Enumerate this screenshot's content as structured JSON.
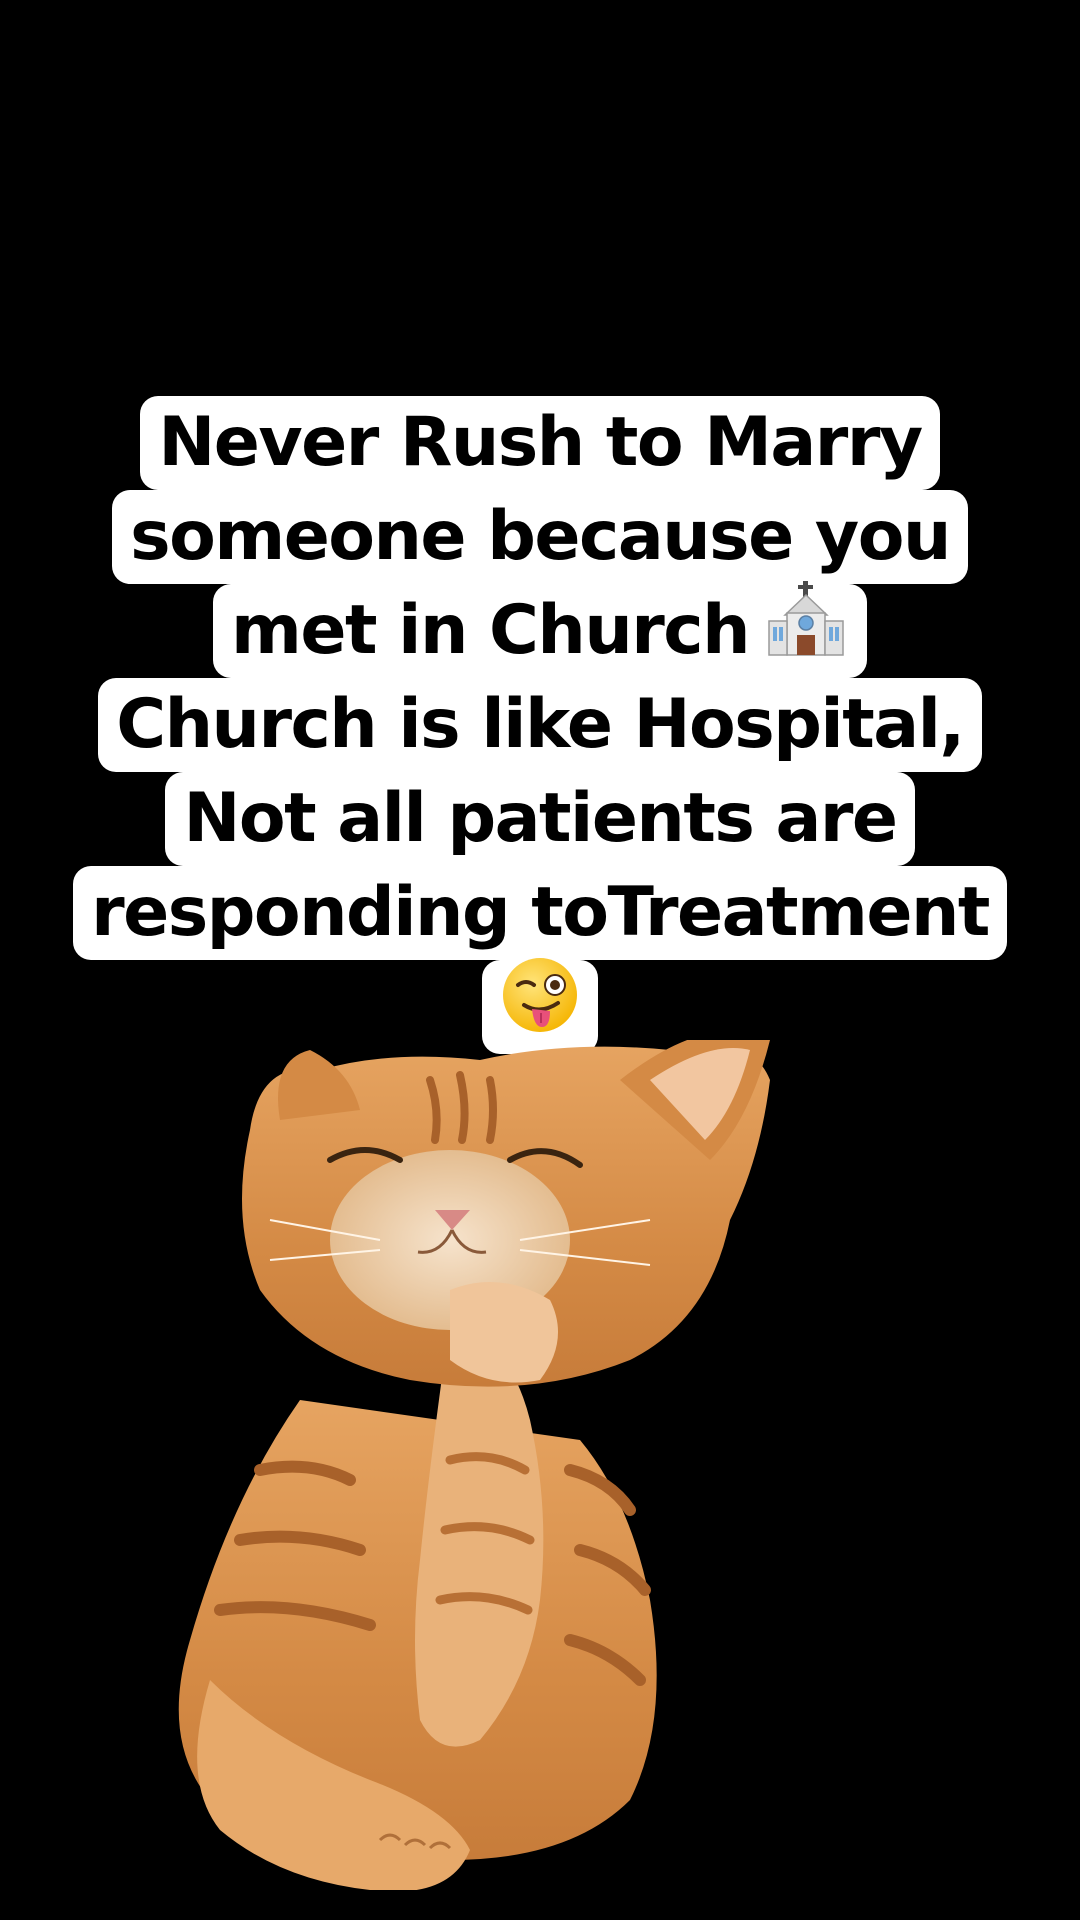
{
  "caption": {
    "lines": [
      "Never Rush to Marry",
      "someone because you",
      "met in Church",
      "Church is like Hospital,",
      "Not all patients are",
      "responding toTreatment",
      ""
    ],
    "line3_emoji": "church-emoji",
    "line7_emoji": "winking-face-with-tongue-emoji"
  },
  "image": {
    "subject": "cat-icon"
  },
  "colors": {
    "background": "#000000",
    "caption_bg": "#ffffff",
    "caption_text": "#000000",
    "cat_fur": "#d9934f",
    "cat_stripes": "#a8612a"
  }
}
